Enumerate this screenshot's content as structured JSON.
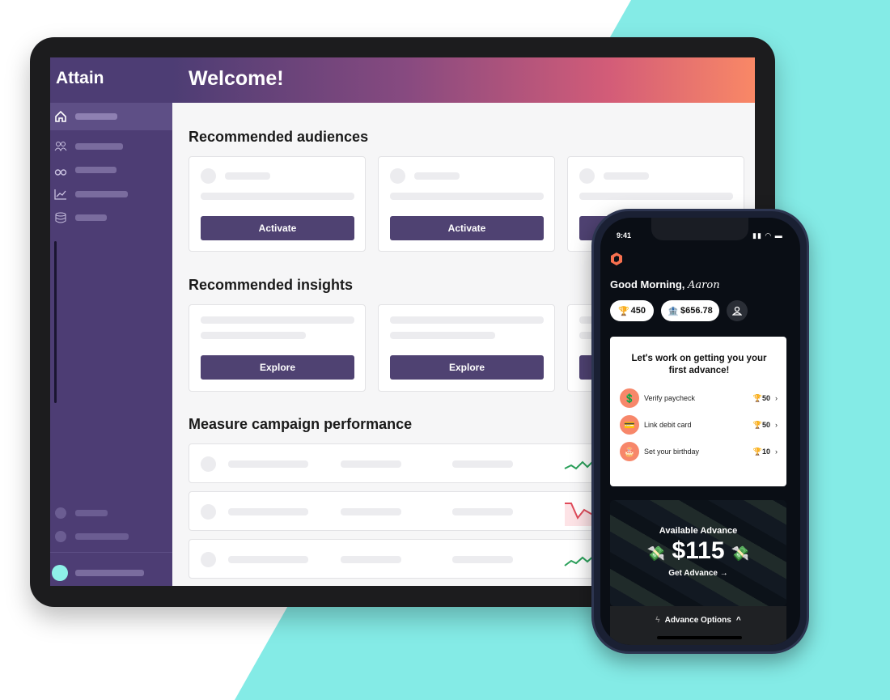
{
  "colors": {
    "teal": "#84ebe6",
    "sidebar": "#4d3d74",
    "button": "#4f4272",
    "accent": "#f98866",
    "phone_bg": "#0a0e15"
  },
  "dashboard": {
    "logo": "Attain",
    "title": "Welcome!",
    "sidebar_icons": [
      "home-icon",
      "users-icon",
      "binoculars-icon",
      "chart-icon",
      "database-icon"
    ],
    "sections": {
      "audiences": "Recommended audiences",
      "insights": "Recommended insights",
      "performance": "Measure campaign performance"
    },
    "audience_button": "Activate",
    "insight_button": "Explore",
    "trend_rows": [
      "up",
      "down",
      "up"
    ]
  },
  "phone": {
    "time": "9:41",
    "greeting": "Good Morning,",
    "name": "Aaron",
    "points": "450",
    "balance": "$656.78",
    "card_title": "Let's work on getting you your first advance!",
    "tasks": [
      {
        "label": "Verify paycheck",
        "points": "50",
        "icon": "💲"
      },
      {
        "label": "Link debit card",
        "points": "50",
        "icon": "💳"
      },
      {
        "label": "Set your birthday",
        "points": "10",
        "icon": "🎂"
      }
    ],
    "advance_label": "Available Advance",
    "advance_amount": "$115",
    "advance_cta": "Get Advance",
    "options_label": "Advance Options"
  }
}
